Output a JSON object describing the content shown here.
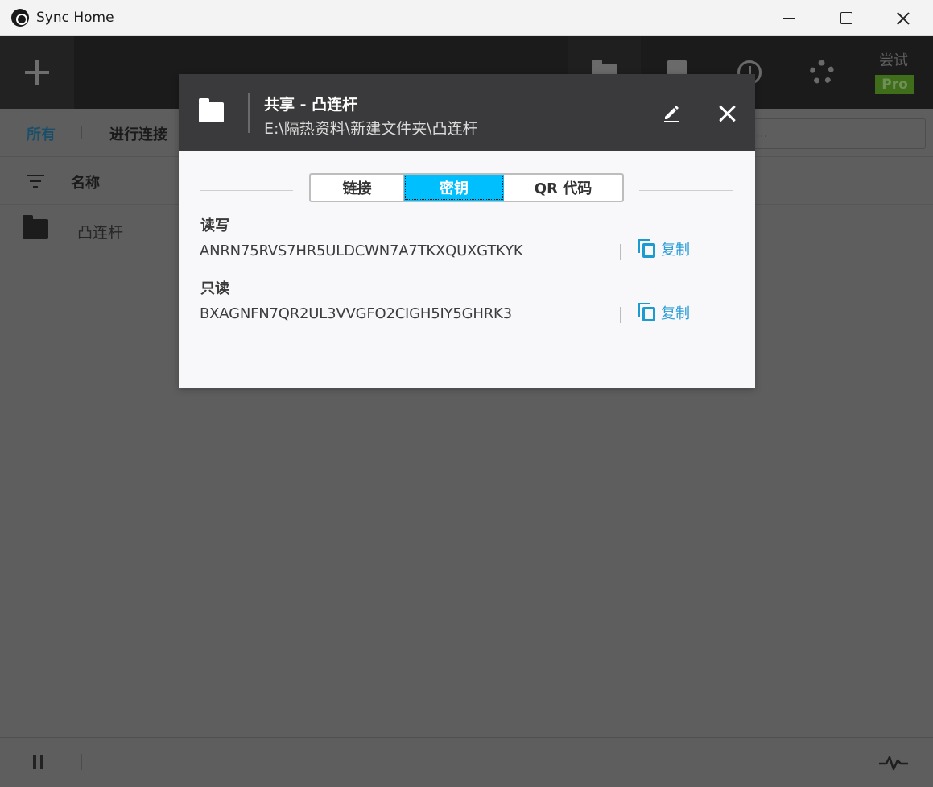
{
  "window": {
    "title": "Sync Home"
  },
  "toolbar": {
    "trial_label": "尝试",
    "pro_label": "Pro"
  },
  "filter_bar": {
    "all_label": "所有",
    "connecting_label": "进行连接",
    "search_placeholder": "..."
  },
  "list": {
    "name_column": "名称",
    "rows": [
      {
        "name": "凸连杆"
      }
    ]
  },
  "dialog": {
    "title": "共享 - 凸连杆",
    "path": "E:\\隔热资料\\新建文件夹\\凸连杆",
    "tabs": [
      {
        "label": "链接",
        "selected": false
      },
      {
        "label": "密钥",
        "selected": true
      },
      {
        "label": "QR 代码",
        "selected": false
      }
    ],
    "read_write": {
      "label": "读写",
      "key": "ANRN75RVS7HR5ULDCWN7A7TKXQUXGTKYK",
      "copy_label": "复制"
    },
    "read_only": {
      "label": "只读",
      "key": "BXAGNFN7QR2UL3VVGFO2CIGH5IY5GHRK3",
      "copy_label": "复制"
    }
  },
  "colors": {
    "accent": "#00bfff",
    "link": "#2c9ed6",
    "dialog_header": "#3a3a3c",
    "pro_badge": "#3f6d1a"
  }
}
